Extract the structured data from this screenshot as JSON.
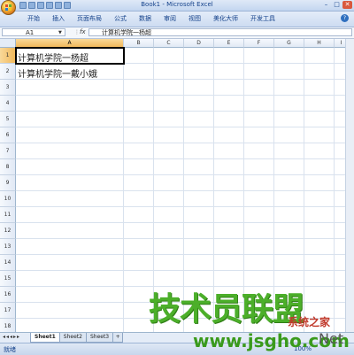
{
  "window": {
    "title": "Book1 - Microsoft Excel",
    "minimize": "–",
    "maximize": "□",
    "close": "✕"
  },
  "ribbon": {
    "tabs": [
      "开始",
      "插入",
      "页面布局",
      "公式",
      "数据",
      "审阅",
      "视图",
      "美化大师",
      "开发工具"
    ],
    "help": "?"
  },
  "formula_bar": {
    "name_box": "A1",
    "fx": "fx",
    "content": "计算机学院一杨超"
  },
  "grid": {
    "columns": [
      "A",
      "B",
      "C",
      "D",
      "E",
      "F",
      "G",
      "H",
      "I"
    ],
    "rows": [
      "1",
      "2",
      "3",
      "4",
      "5",
      "6",
      "7",
      "8",
      "9",
      "10",
      "11",
      "12",
      "13",
      "14",
      "15",
      "16",
      "17",
      "18"
    ],
    "selected_cell": "A1",
    "cells": {
      "A1": "计算机学院一杨超",
      "A2": "计算机学院一戴小娥"
    }
  },
  "sheets": {
    "nav": "◂◂◂▸▸",
    "tabs": [
      "Sheet1",
      "Sheet2",
      "Sheet3"
    ],
    "active": "Sheet1",
    "new_tab": "+"
  },
  "status": {
    "text": "就绪",
    "zoom": "100%"
  },
  "watermark": {
    "main": "技术员联盟",
    "sub": "系统之家",
    "url": "www.jsgho.com",
    "net": "Net"
  },
  "colors": {
    "accent": "#15428b",
    "selection": "#f1b85a"
  }
}
